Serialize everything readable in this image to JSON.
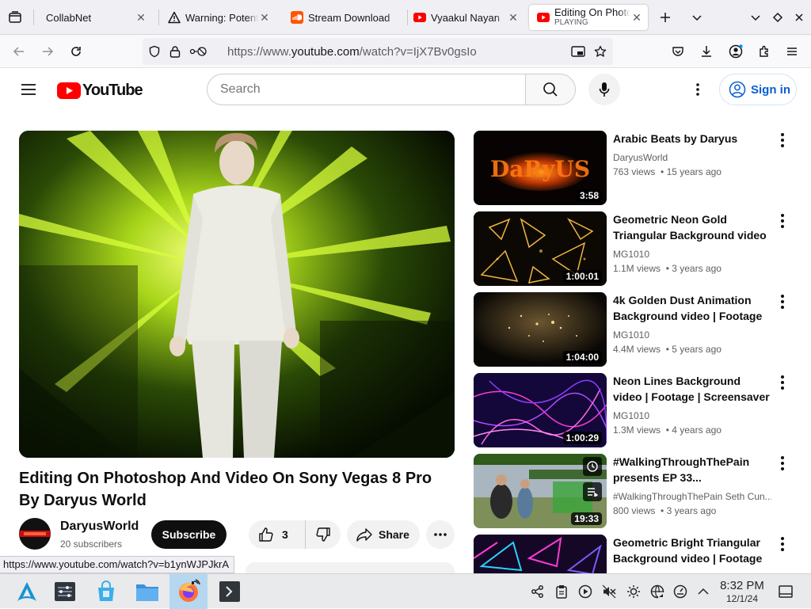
{
  "browser": {
    "tabs": [
      {
        "title": "CollabNet",
        "icon": "collabnet-icon"
      },
      {
        "title": "Warning: Potential Security Risk",
        "icon": "warning-icon"
      },
      {
        "title": "Stream Download",
        "icon": "soundcloud-icon"
      },
      {
        "title": "Vyaakul Nayan",
        "icon": "youtube-icon"
      },
      {
        "title": "Editing On Photoshop",
        "subtitle": "PLAYING",
        "icon": "youtube-icon"
      }
    ],
    "url_prefix": "https://www.",
    "url_domain": "youtube.com",
    "url_rest": "/watch?v=IjX7Bv0gsIo",
    "status_url": "https://www.youtube.com/watch?v=b1ynWJPJkrA"
  },
  "youtube": {
    "logo_text": "YouTube",
    "search_placeholder": "Search",
    "signin_label": "Sign in",
    "video": {
      "title": "Editing On Photoshop And Video On Sony Vegas 8 Pro By Daryus World",
      "channel": "DaryusWorld",
      "subscribers": "20 subscribers",
      "subscribe_label": "Subscribe",
      "likes": "3",
      "share_label": "Share"
    },
    "recommendations": [
      {
        "title": "Arabic Beats by Daryus",
        "channel": "DaryusWorld",
        "views": "763 views",
        "age": "15 years ago",
        "duration": "3:58"
      },
      {
        "title": "Geometric Neon Gold Triangular Background video | Footage |...",
        "channel": "MG1010",
        "views": "1.1M views",
        "age": "3 years ago",
        "duration": "1:00:01"
      },
      {
        "title": "4k Golden Dust Animation Background video | Footage |...",
        "channel": "MG1010",
        "views": "4.4M views",
        "age": "5 years ago",
        "duration": "1:04:00"
      },
      {
        "title": "Neon Lines Background video | Footage | Screensaver",
        "channel": "MG1010",
        "views": "1.3M views",
        "age": "4 years ago",
        "duration": "1:00:29"
      },
      {
        "title": "#WalkingThroughThePain presents EP 33...",
        "channel": "#WalkingThroughThePain Seth Cun...",
        "views": "800 views",
        "age": "3 years ago",
        "duration": "19:33"
      },
      {
        "title": "Geometric Bright Triangular Background video | Footage |...",
        "channel": "",
        "views": "",
        "age": "",
        "duration": ""
      }
    ],
    "meta_separator": "•"
  },
  "taskbar": {
    "time": "8:32 PM",
    "date": "12/1/24"
  },
  "colors": {
    "youtube_red": "#ff0000",
    "link_blue": "#065fd4",
    "subscribe_black": "#0f0f0f"
  }
}
